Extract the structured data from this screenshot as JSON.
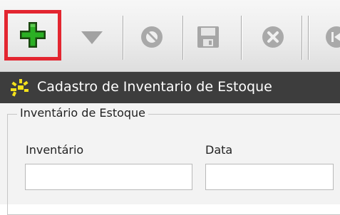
{
  "toolbar": {
    "buttons": [
      {
        "icon": "plus-icon",
        "state": "enabled",
        "highlighted": true
      },
      {
        "icon": "dropdown-arrow-icon",
        "state": "disabled"
      },
      {
        "icon": "cancel-icon",
        "state": "disabled"
      },
      {
        "icon": "save-icon",
        "state": "disabled"
      },
      {
        "icon": "delete-icon",
        "state": "disabled"
      },
      {
        "icon": "first-record-icon",
        "state": "disabled"
      }
    ],
    "highlight_color": "#e32630",
    "plus_color": "#2bb024"
  },
  "window": {
    "title": "Cadastro de Inventario de Estoque",
    "title_bar_color": "#3d3d3d",
    "title_text_color": "#ffffff"
  },
  "form": {
    "group_title": "Inventário de Estoque",
    "fields": [
      {
        "label": "Inventário",
        "value": ""
      },
      {
        "label": "Data",
        "value": ""
      }
    ]
  }
}
